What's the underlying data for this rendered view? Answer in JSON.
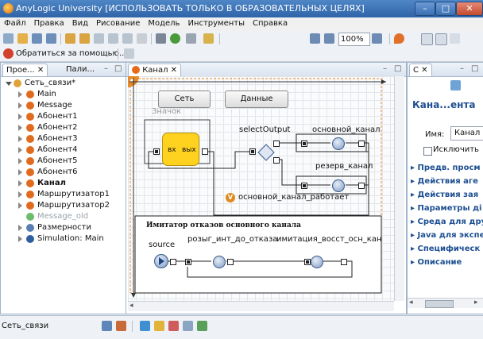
{
  "window": {
    "title": "AnyLogic University [ИСПОЛЬЗОВАТЬ ТОЛЬКО В ОБРАЗОВАТЕЛЬНЫХ ЦЕЛЯХ]",
    "minimize": "–",
    "maximize": "□",
    "close": "✕"
  },
  "menu": [
    "Файл",
    "Правка",
    "Вид",
    "Рисование",
    "Модель",
    "Инструменты",
    "Справка"
  ],
  "toolbar": {
    "zoom": "100%",
    "help_link": "Обратиться за помощью..."
  },
  "projects_panel": {
    "tabs": [
      "Прое...",
      "Пали..."
    ],
    "tree": [
      {
        "label": "Сеть_связи*",
        "level": 0,
        "icon": "model-icon",
        "expanded": true
      },
      {
        "label": "Main",
        "level": 1,
        "icon": "agent-icon"
      },
      {
        "label": "Message",
        "level": 1,
        "icon": "agent-icon"
      },
      {
        "label": "Абонент1",
        "level": 1,
        "icon": "agent-icon"
      },
      {
        "label": "Абонент2",
        "level": 1,
        "icon": "agent-icon"
      },
      {
        "label": "Абонент3",
        "level": 1,
        "icon": "agent-icon"
      },
      {
        "label": "Абонент4",
        "level": 1,
        "icon": "agent-icon"
      },
      {
        "label": "Абонент5",
        "level": 1,
        "icon": "agent-icon"
      },
      {
        "label": "Абонент6",
        "level": 1,
        "icon": "agent-icon"
      },
      {
        "label": "Канал",
        "level": 1,
        "icon": "agent-icon",
        "bold": true
      },
      {
        "label": "Маршрутизатор1",
        "level": 1,
        "icon": "agent-icon"
      },
      {
        "label": "Маршрутизатор2",
        "level": 1,
        "icon": "agent-icon"
      },
      {
        "label": "Message_old",
        "level": 1,
        "icon": "agent-old-icon",
        "muted": true
      },
      {
        "label": "Размерности",
        "level": 1,
        "icon": "dimensions-icon"
      },
      {
        "label": "Simulation: Main",
        "level": 1,
        "icon": "simulation-icon"
      }
    ]
  },
  "editor": {
    "tab": "Канал",
    "buttons": {
      "set": "Сеть",
      "data": "Данные"
    },
    "icon_label": "Значок",
    "block_in": "вх",
    "block_out": "вых",
    "select_output": "selectOutput",
    "main_channel": "основной_канал",
    "reserve_channel": "резерв_канал",
    "variable": "основной_канал_работает",
    "sim_title": "Имитатор отказов основного канала",
    "source": "source",
    "delay1": "розыг_инт_до_отказа",
    "delay2": "имитация_восст_осн_кан"
  },
  "properties_panel": {
    "tab": "С",
    "title": "Кана...ента",
    "name_label": "Имя:",
    "name_value": "Канал",
    "exclude_label": "Исключить",
    "sections": [
      "Предв. просм",
      "Действия аге",
      "Действия зая",
      "Параметры ді",
      "Среда для дру",
      "Java для экспе",
      "Специфическ",
      "Описание"
    ]
  },
  "status": {
    "text": "Сеть_связи"
  },
  "colors": {
    "accent": "#2f65a8",
    "block_yellow": "#ffd21f",
    "variable_orange": "#e08a1e"
  }
}
